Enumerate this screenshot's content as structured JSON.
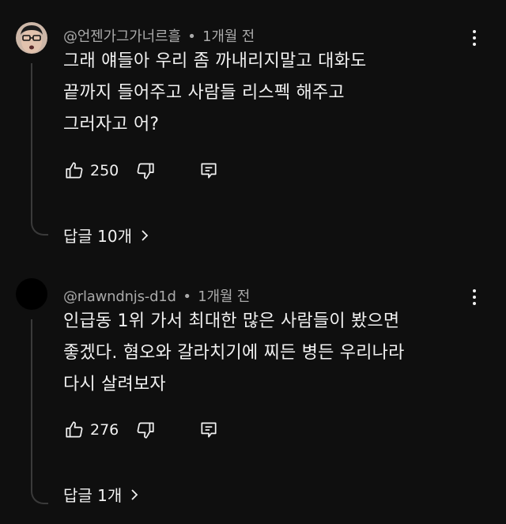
{
  "comments": [
    {
      "author": "@언젠가그가너르흘",
      "separator": "•",
      "time": "1개월 전",
      "lines": [
        "그래 얘들아 우리 좀 까내리지말고 대화도",
        "끝까지 들어주고 사람들 리스펙 해주고",
        "그러자고 어?"
      ],
      "likes": "250",
      "replies_label": "답글 10개"
    },
    {
      "author": "@rlawndnjs-d1d",
      "separator": "•",
      "time": "1개월 전",
      "lines": [
        "인급동 1위 가서 최대한 많은 사람들이 봤으면",
        "좋겠다. 혐오와 갈라치기에 찌든 병든 우리나라",
        "다시 살려보자"
      ],
      "likes": "276",
      "replies_label": "답글 1개"
    }
  ],
  "icons": {
    "like": "thumbs-up-icon",
    "dislike": "thumbs-down-icon",
    "reply": "reply-comment-icon",
    "more": "more-vertical-icon",
    "expand": "chevron-right-icon"
  },
  "colors": {
    "background": "#0f0f0f",
    "text": "#f1f1f1",
    "meta": "#aaaaaa",
    "thread_line": "#3a3a3a"
  }
}
